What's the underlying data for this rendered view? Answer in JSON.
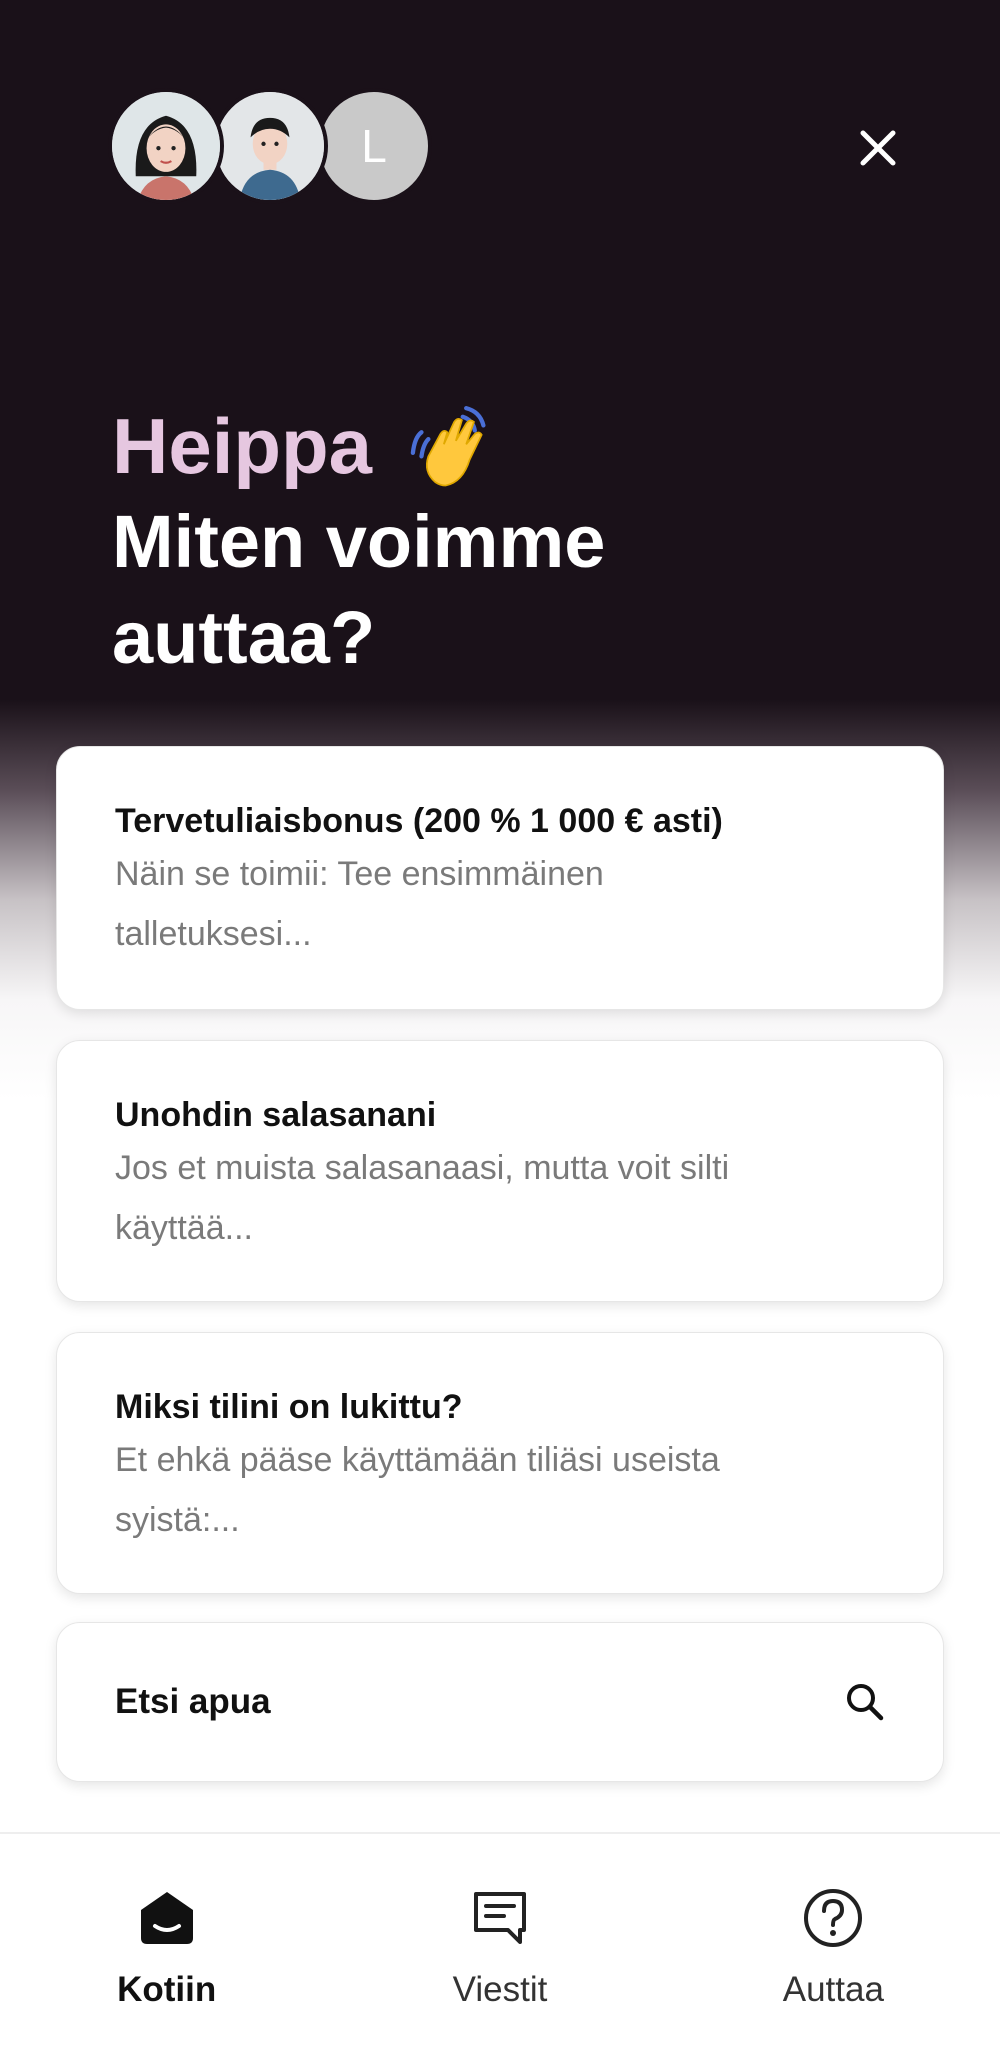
{
  "header": {
    "avatars": [
      {
        "type": "illustration",
        "name": "woman-avatar"
      },
      {
        "type": "illustration",
        "name": "man-avatar"
      },
      {
        "type": "initial",
        "letter": "L"
      }
    ],
    "close_icon": "close-icon"
  },
  "greeting": {
    "hello": "Heippa",
    "hello_emoji": "waving-hand-icon",
    "question_line1": "Miten voimme",
    "question_line2": "auttaa?"
  },
  "articles": [
    {
      "title": "Tervetuliaisbonus (200 % 1 000 € asti)",
      "desc_line1": "Näin se toimii: Tee ensimmäinen",
      "desc_line2": "talletuksesi..."
    },
    {
      "title": "Unohdin salasanani",
      "desc_line1": "Jos et muista salasanaasi, mutta voit silti",
      "desc_line2": "käyttää..."
    },
    {
      "title": "Miksi tilini on lukittu?",
      "desc_line1": "Et ehkä pääse käyttämään tiliäsi useista",
      "desc_line2": "syistä:..."
    }
  ],
  "search": {
    "label": "Etsi apua",
    "icon": "search-icon"
  },
  "nav": {
    "items": [
      {
        "label": "Kotiin",
        "icon": "home-icon",
        "active": true
      },
      {
        "label": "Viestit",
        "icon": "messages-icon",
        "active": false
      },
      {
        "label": "Auttaa",
        "icon": "help-icon",
        "active": false
      }
    ]
  },
  "colors": {
    "hero_bg": "#1a1119",
    "greeting_accent": "#e6c7e0",
    "text_primary": "#111111",
    "text_secondary": "#7a7a7a"
  }
}
